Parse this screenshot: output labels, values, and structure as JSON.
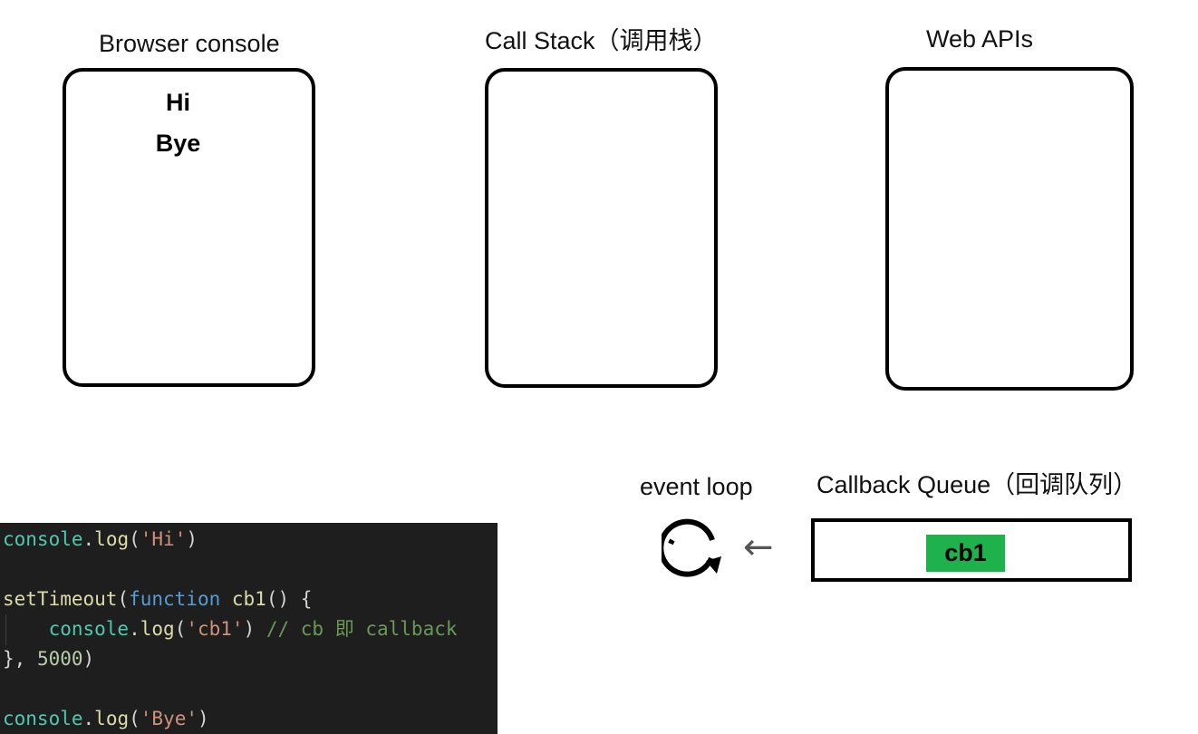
{
  "colors": {
    "queue_item": "#1fb14b",
    "code_background": "#1e1e1e",
    "code_object": "#4ec9b0",
    "code_function": "#dcdcaa",
    "code_string": "#ce9178",
    "code_keyword": "#569cd6",
    "code_number": "#b5cea8",
    "code_comment": "#6a9955"
  },
  "panels": {
    "browser_console": {
      "title": "Browser console",
      "lines": [
        "Hi",
        "Bye"
      ]
    },
    "call_stack": {
      "title": "Call Stack（调用栈）"
    },
    "web_apis": {
      "title": "Web APIs"
    }
  },
  "event_loop": {
    "label": "event loop",
    "icon": "refresh-loop-icon",
    "arrow": "←"
  },
  "callback_queue": {
    "title": "Callback Queue（回调队列）",
    "items": [
      "cb1"
    ]
  },
  "code": {
    "line1": {
      "obj": "console",
      "dot": ".",
      "fn": "log",
      "open": "(",
      "str": "'Hi'",
      "close": ")"
    },
    "line3": {
      "fn": "setTimeout",
      "open": "(",
      "kw": "function",
      "name": " cb1",
      "rest": "() {"
    },
    "line4": {
      "indent": "    ",
      "obj": "console",
      "dot": ".",
      "fn": "log",
      "open": "(",
      "str": "'cb1'",
      "close": ")",
      "comment": " // cb 即 callback"
    },
    "line5": {
      "start": "}, ",
      "num": "5000",
      "close": ")"
    },
    "line7": {
      "obj": "console",
      "dot": ".",
      "fn": "log",
      "open": "(",
      "str": "'Bye'",
      "close": ")"
    }
  }
}
